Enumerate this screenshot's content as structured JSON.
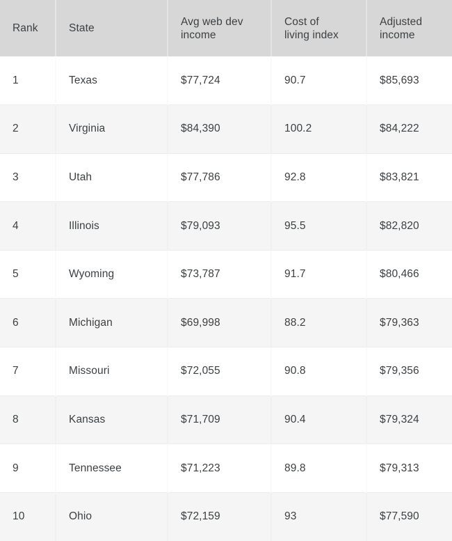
{
  "table": {
    "columns": [
      {
        "key": "rank",
        "label": "Rank",
        "label_lines": [
          "Rank"
        ]
      },
      {
        "key": "state",
        "label": "State",
        "label_lines": [
          "State"
        ]
      },
      {
        "key": "avg_web_dev_income",
        "label": "Avg web dev income",
        "label_lines": [
          "Avg web dev",
          "income"
        ]
      },
      {
        "key": "cost_of_living_index",
        "label": "Cost of living index",
        "label_lines": [
          "Cost of",
          "living index"
        ]
      },
      {
        "key": "adjusted_income",
        "label": "Adjusted income",
        "label_lines": [
          "Adjusted",
          "income"
        ]
      }
    ],
    "rows": [
      {
        "rank": "1",
        "state": "Texas",
        "avg_web_dev_income": "$77,724",
        "cost_of_living_index": "90.7",
        "adjusted_income": "$85,693"
      },
      {
        "rank": "2",
        "state": "Virginia",
        "avg_web_dev_income": "$84,390",
        "cost_of_living_index": "100.2",
        "adjusted_income": "$84,222"
      },
      {
        "rank": "3",
        "state": "Utah",
        "avg_web_dev_income": "$77,786",
        "cost_of_living_index": "92.8",
        "adjusted_income": "$83,821"
      },
      {
        "rank": "4",
        "state": "Illinois",
        "avg_web_dev_income": "$79,093",
        "cost_of_living_index": "95.5",
        "adjusted_income": "$82,820"
      },
      {
        "rank": "5",
        "state": "Wyoming",
        "avg_web_dev_income": "$73,787",
        "cost_of_living_index": "91.7",
        "adjusted_income": "$80,466"
      },
      {
        "rank": "6",
        "state": "Michigan",
        "avg_web_dev_income": "$69,998",
        "cost_of_living_index": "88.2",
        "adjusted_income": "$79,363"
      },
      {
        "rank": "7",
        "state": "Missouri",
        "avg_web_dev_income": "$72,055",
        "cost_of_living_index": "90.8",
        "adjusted_income": "$79,356"
      },
      {
        "rank": "8",
        "state": "Kansas",
        "avg_web_dev_income": "$71,709",
        "cost_of_living_index": "90.4",
        "adjusted_income": "$79,324"
      },
      {
        "rank": "9",
        "state": "Tennessee",
        "avg_web_dev_income": "$71,223",
        "cost_of_living_index": "89.8",
        "adjusted_income": "$79,313"
      },
      {
        "rank": "10",
        "state": "Ohio",
        "avg_web_dev_income": "$72,159",
        "cost_of_living_index": "93",
        "adjusted_income": "$77,590"
      }
    ],
    "colors": {
      "header_background": "#d7d7d7",
      "row_odd_background": "#ffffff",
      "row_even_background": "#f5f5f5",
      "text": "#3c4043",
      "row_divider": "#ededed"
    }
  }
}
